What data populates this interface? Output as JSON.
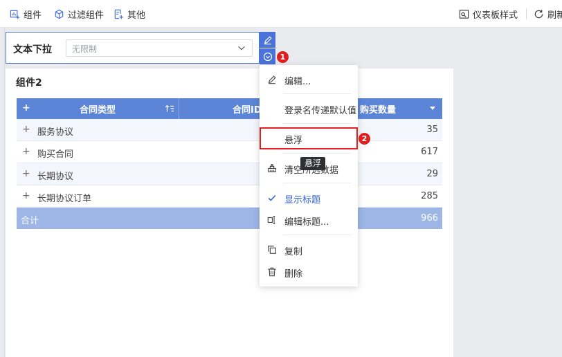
{
  "toolbar": {
    "component_label": "组件",
    "filter_component_label": "过滤组件",
    "other_label": "其他",
    "dashboard_style_label": "仪表板样式",
    "refresh_label": "刷新"
  },
  "filter_widget": {
    "label": "文本下拉",
    "placeholder": "无限制"
  },
  "component": {
    "title": "组件2",
    "columns": [
      "合同类型",
      "合同ID",
      "购买数量"
    ],
    "rows": [
      {
        "name": "服务协议",
        "value": "35"
      },
      {
        "name": "购买合同",
        "value": "617"
      },
      {
        "name": "长期协议",
        "value": "29"
      },
      {
        "name": "长期协议订单",
        "value": "285"
      }
    ],
    "total_label": "合计",
    "total_value": "966"
  },
  "context_menu": {
    "edit": "编辑...",
    "login_default": "登录名传递默认值",
    "float": "悬浮",
    "clear_data": "清空所选数据",
    "show_title": "显示标题",
    "edit_title": "编辑标题...",
    "copy": "复制",
    "delete": "删除"
  },
  "tooltip": "悬浮",
  "badges": [
    "1",
    "2"
  ],
  "colors": {
    "accent": "#4a72d8",
    "header": "#5d85d7",
    "total_row": "#9db6e6",
    "highlight": "#e02020"
  }
}
